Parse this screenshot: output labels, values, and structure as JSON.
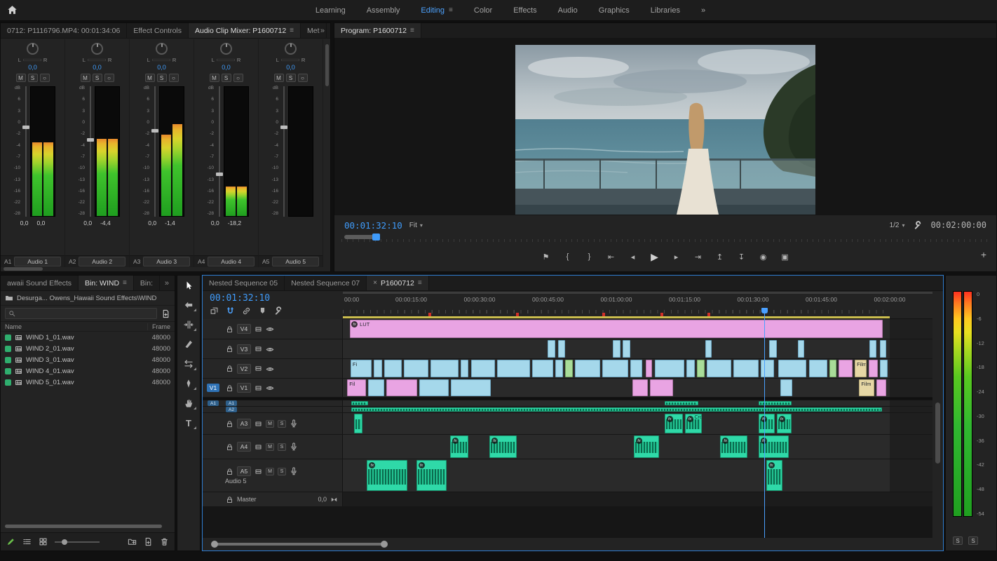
{
  "ui": {
    "menu_glyph": "≡",
    "overflow_glyph": "»",
    "close_glyph": "×",
    "caret_glyph": "▾",
    "plus_glyph": "+",
    "home_glyph": "⌂"
  },
  "colors": {
    "accent": "#2d8ceb",
    "timecode": "#3f9bfa",
    "clip_cyan": "#a5d8eb",
    "clip_pink": "#e9a4e3",
    "clip_green": "#a9dc99",
    "clip_tan": "#e6d7a5",
    "audio_clip": "#2fd9a8"
  },
  "topbar": {
    "workspaces": [
      {
        "label": "Learning",
        "active": false
      },
      {
        "label": "Assembly",
        "active": false
      },
      {
        "label": "Editing",
        "active": true
      },
      {
        "label": "Color",
        "active": false
      },
      {
        "label": "Effects",
        "active": false
      },
      {
        "label": "Audio",
        "active": false
      },
      {
        "label": "Graphics",
        "active": false
      },
      {
        "label": "Libraries",
        "active": false
      }
    ]
  },
  "mixer": {
    "tabs": [
      {
        "label": "0712: P1116796.MP4: 00:01:34:06",
        "active": false
      },
      {
        "label": "Effect Controls",
        "active": false
      },
      {
        "label": "Audio Clip Mixer: P1600712",
        "active": true
      },
      {
        "label": "Met",
        "active": false
      }
    ],
    "pan_left": "L",
    "pan_right": "R",
    "mute_label": "M",
    "solo_label": "S",
    "keyframe_glyph": "○",
    "db_scale": [
      "dB",
      "6",
      "3",
      "0",
      "-2",
      "-4",
      "-7",
      "-10",
      "-13",
      "-16",
      "-22",
      "-28"
    ],
    "channels": [
      {
        "track": "A1",
        "name": "Audio 1",
        "pan": "0,0",
        "gain": "0,0",
        "peak": "0,0",
        "fader_pct": 30,
        "meters": [
          57,
          57
        ]
      },
      {
        "track": "A2",
        "name": "Audio 2",
        "pan": "0,0",
        "gain": "0,0",
        "peak": "-4,4",
        "fader_pct": 40,
        "meters": [
          60,
          60
        ]
      },
      {
        "track": "A3",
        "name": "Audio 3",
        "pan": "0,0",
        "gain": "0,0",
        "peak": "-1,4",
        "fader_pct": 33,
        "meters": [
          63,
          71
        ]
      },
      {
        "track": "A4",
        "name": "Audio 4",
        "pan": "0,0",
        "gain": "0,0",
        "peak": "-18,2",
        "fader_pct": 66,
        "meters": [
          23,
          23
        ]
      },
      {
        "track": "A5",
        "name": "Audio 5",
        "pan": "0,0",
        "gain": "",
        "peak": "",
        "fader_pct": 30,
        "meters": [
          0,
          0
        ]
      }
    ]
  },
  "program": {
    "tab": "Program: P1600712",
    "timecode": "00:01:32:10",
    "zoom_level": "Fit",
    "playback_resolution": "1/2",
    "duration": "00:02:00:00",
    "scrub_playhead_pct": 4.8,
    "transport": [
      {
        "name": "add-marker",
        "glyph": "⚑"
      },
      {
        "name": "mark-in",
        "glyph": "{"
      },
      {
        "name": "mark-out",
        "glyph": "}"
      },
      {
        "name": "go-to-in",
        "glyph": "⇤"
      },
      {
        "name": "step-back",
        "glyph": "◂"
      },
      {
        "name": "play",
        "glyph": "▶"
      },
      {
        "name": "step-forward",
        "glyph": "▸"
      },
      {
        "name": "go-to-out",
        "glyph": "⇥"
      },
      {
        "name": "lift",
        "glyph": "↥"
      },
      {
        "name": "extract",
        "glyph": "↧"
      },
      {
        "name": "export-frame",
        "glyph": "◉"
      },
      {
        "name": "comparison-view",
        "glyph": "▣"
      }
    ]
  },
  "project": {
    "tabs": [
      {
        "label": "awaii Sound Effects",
        "active": false
      },
      {
        "label": "Bin: WIND",
        "active": true
      },
      {
        "label": "Bin:",
        "active": false
      }
    ],
    "breadcrumb": "Desurga... Owens_Hawaii Sound Effects\\WIND",
    "columns": [
      "Name",
      "Frame"
    ],
    "rows": [
      {
        "name": "WIND 1_01.wav",
        "frame": "48000"
      },
      {
        "name": "WIND 2_01.wav",
        "frame": "48000"
      },
      {
        "name": "WIND 3_01.wav",
        "frame": "48000"
      },
      {
        "name": "WIND 4_01.wav",
        "frame": "48000"
      },
      {
        "name": "WIND 5_01.wav",
        "frame": "48000"
      }
    ]
  },
  "tools": [
    {
      "name": "selection",
      "active": true,
      "flyout": false
    },
    {
      "name": "track-select-forward",
      "active": false,
      "flyout": true
    },
    {
      "name": "ripple-edit",
      "active": false,
      "flyout": true
    },
    {
      "name": "razor",
      "active": false,
      "flyout": false
    },
    {
      "name": "slip",
      "active": false,
      "flyout": true
    },
    {
      "name": "pen",
      "active": false,
      "flyout": true
    },
    {
      "name": "hand",
      "active": false,
      "flyout": true
    },
    {
      "name": "type",
      "active": false,
      "flyout": true
    }
  ],
  "timeline": {
    "tabs": [
      {
        "label": "Nested Sequence 05",
        "active": false
      },
      {
        "label": "Nested Sequence 07",
        "active": false
      },
      {
        "label": "P1600712",
        "active": true
      }
    ],
    "timecode": "00:01:32:10",
    "toolbar": [
      "nest",
      "snap",
      "linked-selection",
      "add-marker",
      "timeline-settings"
    ],
    "snap_active": true,
    "ruler": [
      "00:00",
      "00:00:15:00",
      "00:00:30:00",
      "00:00:45:00",
      "00:01:00:00",
      "00:01:15:00",
      "00:01:30:00",
      "00:01:45:00",
      "00:02:00:00"
    ],
    "markers_pct": [
      15.6,
      31.7,
      47.4,
      58.1,
      66.7
    ],
    "playhead_pct": 77,
    "video_tracks": [
      {
        "id": "V4",
        "clips": [
          {
            "l": 1.3,
            "w": 97.4,
            "c": "pink",
            "label": "LUT",
            "fx": true
          }
        ]
      },
      {
        "id": "V3",
        "clips": [
          {
            "l": 37.4,
            "w": 1.4,
            "c": "cyan"
          },
          {
            "l": 39.4,
            "w": 1.3,
            "c": "cyan"
          },
          {
            "l": 49.4,
            "w": 1.4,
            "c": "cyan"
          },
          {
            "l": 51.2,
            "w": 1.4,
            "c": "cyan"
          },
          {
            "l": 66.3,
            "w": 1.1,
            "c": "cyan"
          },
          {
            "l": 78.0,
            "w": 1.3,
            "c": "cyan"
          },
          {
            "l": 83.2,
            "w": 1.1,
            "c": "cyan"
          },
          {
            "l": 96.3,
            "w": 1.3,
            "c": "cyan"
          },
          {
            "l": 98.2,
            "w": 1.2,
            "c": "cyan"
          }
        ]
      },
      {
        "id": "V2",
        "clips": [
          {
            "l": 1.4,
            "w": 3.8,
            "c": "cyan",
            "label": "Fi"
          },
          {
            "l": 5.6,
            "w": 1.6,
            "c": "cyan"
          },
          {
            "l": 7.6,
            "w": 3.2,
            "c": "cyan"
          },
          {
            "l": 11.2,
            "w": 4.4,
            "c": "cyan"
          },
          {
            "l": 16.0,
            "w": 5.2,
            "c": "cyan"
          },
          {
            "l": 21.6,
            "w": 1.4,
            "c": "cyan"
          },
          {
            "l": 23.4,
            "w": 4.4,
            "c": "cyan"
          },
          {
            "l": 28.2,
            "w": 6.0,
            "c": "cyan"
          },
          {
            "l": 34.6,
            "w": 3.8,
            "c": "cyan"
          },
          {
            "l": 38.8,
            "w": 1.4,
            "c": "cyan"
          },
          {
            "l": 40.6,
            "w": 1.4,
            "c": "green"
          },
          {
            "l": 42.4,
            "w": 4.6,
            "c": "cyan"
          },
          {
            "l": 47.4,
            "w": 4.8,
            "c": "cyan"
          },
          {
            "l": 52.6,
            "w": 2.2,
            "c": "cyan"
          },
          {
            "l": 55.4,
            "w": 1.2,
            "c": "pink"
          },
          {
            "l": 57.0,
            "w": 5.4,
            "c": "cyan"
          },
          {
            "l": 62.8,
            "w": 1.6,
            "c": "cyan"
          },
          {
            "l": 64.8,
            "w": 1.4,
            "c": "green"
          },
          {
            "l": 66.6,
            "w": 4.4,
            "c": "cyan"
          },
          {
            "l": 71.4,
            "w": 4.6,
            "c": "cyan"
          },
          {
            "l": 76.4,
            "w": 2.4,
            "c": "cyan"
          },
          {
            "l": 79.6,
            "w": 5.2,
            "c": "cyan"
          },
          {
            "l": 85.2,
            "w": 3.4,
            "c": "cyan"
          },
          {
            "l": 89.0,
            "w": 1.2,
            "c": "green"
          },
          {
            "l": 90.6,
            "w": 2.6,
            "c": "pink"
          },
          {
            "l": 93.6,
            "w": 2.2,
            "c": "tan",
            "label": "Film"
          },
          {
            "l": 96.2,
            "w": 1.6,
            "c": "pink"
          },
          {
            "l": 98.2,
            "w": 1.4,
            "c": "cyan"
          }
        ]
      },
      {
        "id": "V1",
        "patched": true,
        "clips": [
          {
            "l": 0.8,
            "w": 3.4,
            "c": "pink",
            "label": "Fil"
          },
          {
            "l": 4.6,
            "w": 3.0,
            "c": "cyan"
          },
          {
            "l": 8.0,
            "w": 5.6,
            "c": "pink"
          },
          {
            "l": 14.0,
            "w": 5.4,
            "c": "cyan"
          },
          {
            "l": 19.8,
            "w": 7.2,
            "c": "cyan"
          },
          {
            "l": 53.0,
            "w": 2.8,
            "c": "pink"
          },
          {
            "l": 56.2,
            "w": 4.2,
            "c": "pink"
          },
          {
            "l": 80.0,
            "w": 2.2,
            "c": "cyan"
          },
          {
            "l": 94.4,
            "w": 2.8,
            "c": "tan",
            "label": "Film"
          },
          {
            "l": 97.6,
            "w": 1.8,
            "c": "pink"
          }
        ]
      }
    ],
    "audio_tracks": [
      {
        "id": "A1",
        "collapsed": true,
        "patched": true,
        "clips": [
          {
            "l": 1.6,
            "w": 3.0
          },
          {
            "l": 58.8,
            "w": 6.2
          },
          {
            "l": 76.0,
            "w": 6.0
          }
        ]
      },
      {
        "id": "A2",
        "collapsed": true,
        "clips": [
          {
            "l": 1.6,
            "w": 97.0
          }
        ]
      },
      {
        "id": "A3",
        "clips": [
          {
            "l": 2.0,
            "w": 1.6,
            "label": "1"
          },
          {
            "l": 58.8,
            "w": 3.4,
            "fx": true
          },
          {
            "l": 62.5,
            "w": 3.2,
            "fx": true,
            "label": "Cro"
          },
          {
            "l": 76.0,
            "w": 3.0,
            "fx": true
          },
          {
            "l": 79.3,
            "w": 2.8,
            "fx": true
          }
        ]
      },
      {
        "id": "A4",
        "clips": [
          {
            "l": 19.6,
            "w": 3.4,
            "fx": true
          },
          {
            "l": 26.8,
            "w": 5.0,
            "fx": true
          },
          {
            "l": 53.2,
            "w": 4.6,
            "fx": true
          },
          {
            "l": 69.0,
            "w": 5.0,
            "fx": true
          },
          {
            "l": 76.0,
            "w": 5.6,
            "fx": true
          }
        ]
      },
      {
        "id": "A5",
        "name": "Audio 5",
        "clips": [
          {
            "l": 4.4,
            "w": 7.4,
            "fx": true
          },
          {
            "l": 13.4,
            "w": 5.6,
            "fx": true
          },
          {
            "l": 77.4,
            "w": 3.0,
            "fx": true
          }
        ]
      }
    ],
    "master": {
      "label": "Master",
      "level": "0,0"
    }
  },
  "meters": {
    "scale": [
      "0",
      "-6",
      "-12",
      "-18",
      "-24",
      "-30",
      "-36",
      "-42",
      "-48",
      "-54"
    ],
    "solo_labels": [
      "S",
      "S"
    ]
  }
}
